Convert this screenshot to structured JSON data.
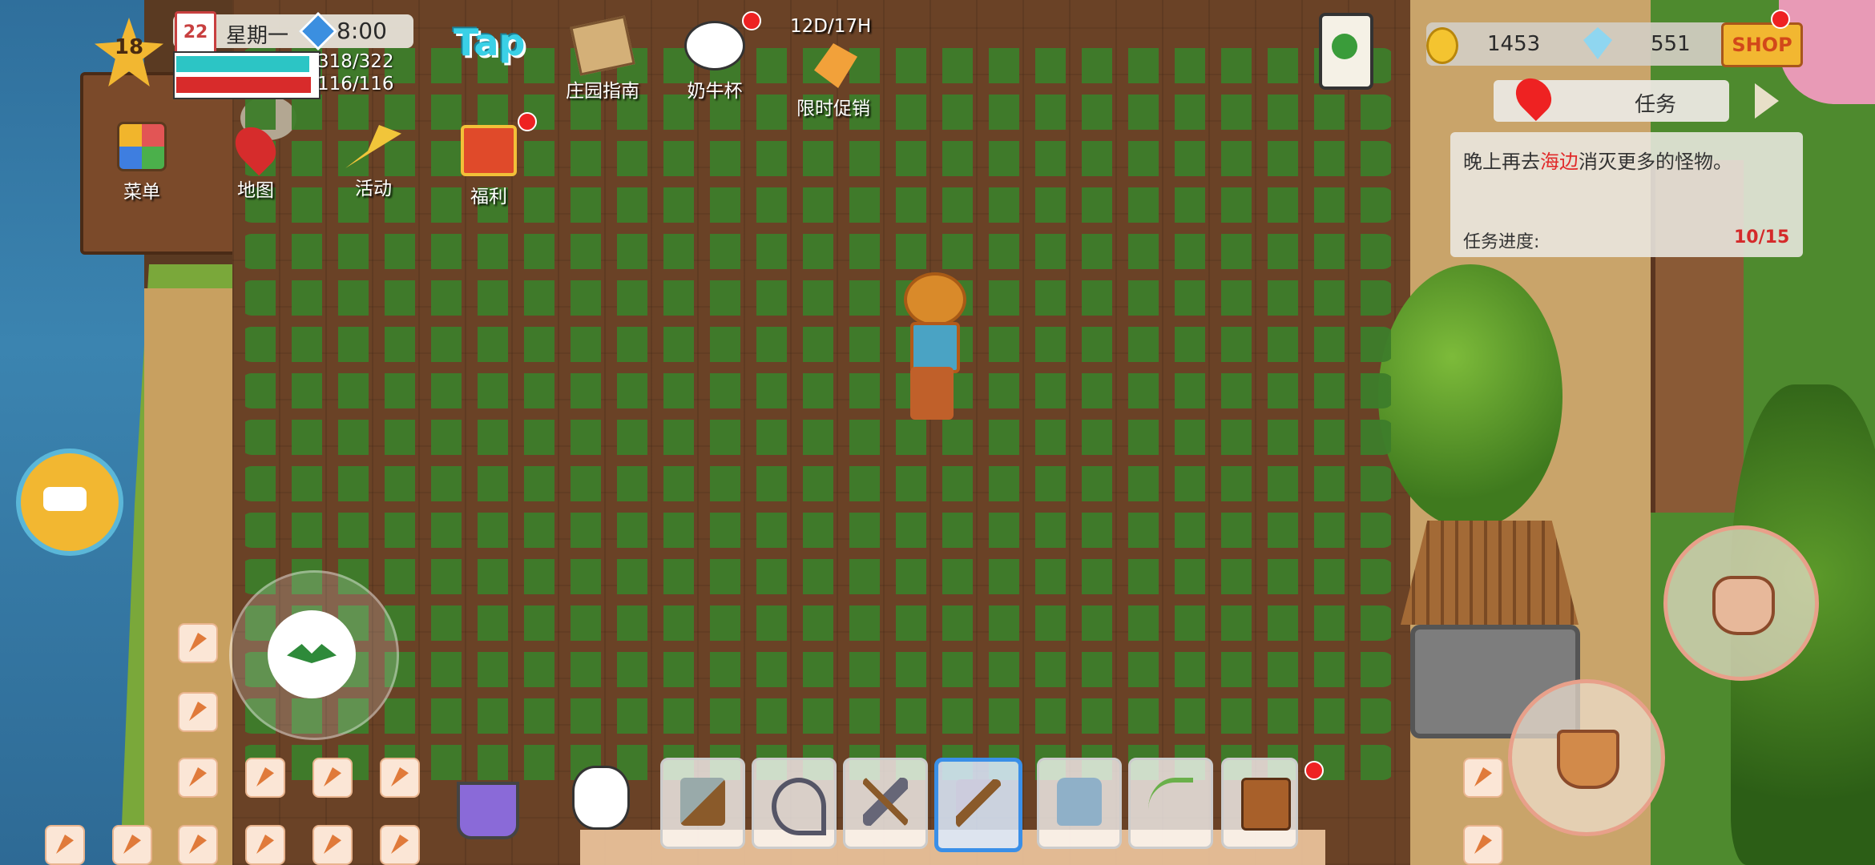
{
  "status": {
    "level": "18",
    "date_day": "22",
    "weekday": "星期一",
    "time": "8:00",
    "hp": "318/322",
    "hp_fraction": 0.988,
    "energy": "116/116",
    "energy_fraction": 1.0,
    "weather_icon": "rain-icon"
  },
  "top_menu": {
    "menu_label": "菜单",
    "map_label": "地图",
    "events_label": "活动",
    "welfare_label": "福利",
    "tap_logo": "Tap",
    "guide_label": "庄园指南",
    "cow_cup_label": "奶牛杯",
    "promo_label": "限时促销",
    "promo_timer": "12D/17H"
  },
  "currency": {
    "coins": "1453",
    "gems": "551",
    "shop_label": "SHOP"
  },
  "quest": {
    "tab_label": "任务",
    "desc_before": "晚上再去",
    "desc_highlight": "海边",
    "desc_after": "消灭更多的怪物。",
    "progress_label": "任务进度:",
    "progress_value": "10/15",
    "highlight_color": "#e12a2a"
  },
  "hotbar": {
    "items": [
      "bucket-icon",
      "cow-icon",
      "axe-icon",
      "sickle-icon",
      "pickaxe-icon",
      "shovel-icon",
      "watering-can-icon",
      "fishing-rod-icon",
      "chest-icon"
    ],
    "selected": "shovel-icon"
  },
  "colors": {
    "hp": "#2cc5c5",
    "energy": "#d82b2b",
    "selected_slot": "#3a8fe8",
    "soil": "#6a4226"
  }
}
